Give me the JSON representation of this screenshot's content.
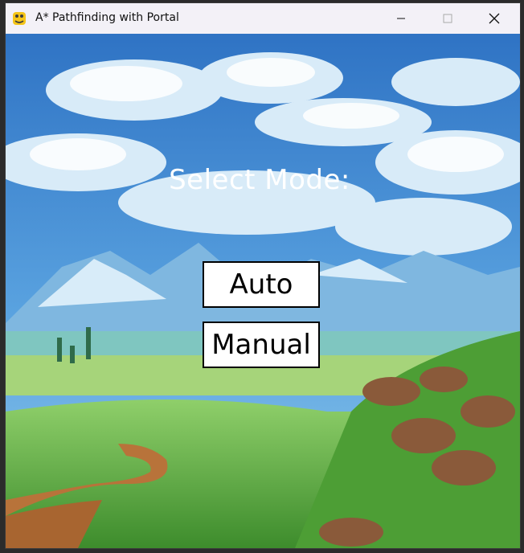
{
  "window": {
    "title": "A* Pathfinding with Portal",
    "app_icon": "pygame-snake-icon",
    "controls": [
      "minimize-icon",
      "maximize-icon",
      "close-icon"
    ]
  },
  "menu": {
    "heading": "Select Mode:",
    "buttons": {
      "auto": "Auto",
      "manual": "Manual"
    }
  },
  "colors": {
    "sky": "#3b7fd0",
    "button_bg": "#ffffff",
    "button_border": "#000000",
    "heading_text": "#ffffff"
  }
}
